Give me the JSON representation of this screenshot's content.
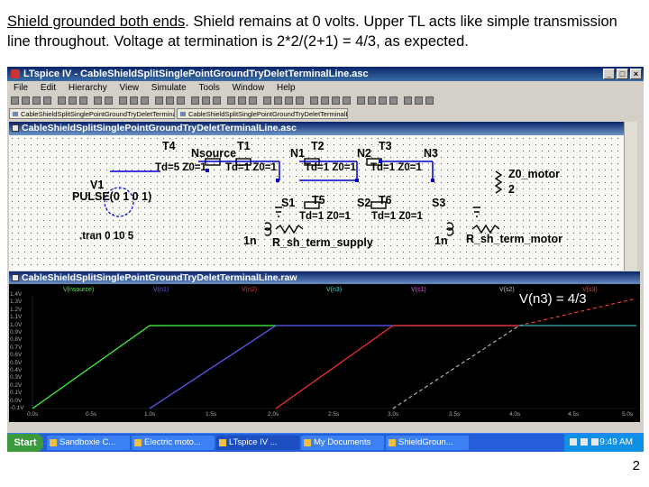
{
  "caption": {
    "part1": "Shield grounded both ends",
    "part2": ".  Shield remains at 0 volts. Upper TL acts like simple transmission line throughout.  Voltage at termination is 2*2/(2+1) = 4/3, as expected."
  },
  "slide_number": "2",
  "window": {
    "title": "LTspice IV - CableShieldSplitSinglePointGroundTryDeletTerminalLine.asc"
  },
  "menu": [
    "File",
    "Edit",
    "Hierarchy",
    "View",
    "Simulate",
    "Tools",
    "Window",
    "Help"
  ],
  "tabs": [
    "CableShieldSplitSinglePointGroundTryDeletTerminalLine.asc",
    "CableShieldSplitSinglePointGroundTryDeletTerminalLine.raw"
  ],
  "schematic": {
    "title": "CableShieldSplitSinglePointGroundTryDeletTerminalLine.asc",
    "labels": {
      "t4": "T4",
      "nsource": "Nsource",
      "t1": "T1",
      "n1": "N1",
      "t2": "T2",
      "n2": "N2",
      "t3": "T3",
      "n3": "N3",
      "td5": "Td=5 Z0=1",
      "td1a": "Td=1 Z0=1",
      "td1b": "Td=1 Z0=1",
      "td1c": "Td=1 Z0=1",
      "v1": "V1",
      "pulse": "PULSE(0 1 0 1)",
      "z0motor": "Z0_motor",
      "z0val": "2",
      "s1": "S1",
      "t5": "T5",
      "s2": "S2",
      "t6": "T6",
      "s3": "S3",
      "td1d": "Td=1 Z0=1",
      "td1e": "Td=1 Z0=1",
      "tran": ".tran 0 10 5",
      "ind1": "1n",
      "rsupply": "R_sh_term_supply",
      "ind2": "1n",
      "rmotor": "R_sh_term_motor"
    }
  },
  "waveform": {
    "title": "CableShieldSplitSinglePointGroundTryDeletTerminalLine.raw",
    "traces": [
      {
        "label": "V(nsource)",
        "color": "#40ff40"
      },
      {
        "label": "V(n1)",
        "color": "#6060ff"
      },
      {
        "label": "V(n2)",
        "color": "#ff3030"
      },
      {
        "label": "V(n3)",
        "color": "#40e0e0"
      },
      {
        "label": "V(s1)",
        "color": "#ff40ff"
      },
      {
        "label": "V(s2)",
        "color": "#c0c0c0"
      },
      {
        "label": "V(s3)",
        "color": "#ff4040"
      }
    ],
    "annotation": "V(n3) = 4/3",
    "y_ticks": [
      "1.4V",
      "1.3V",
      "1.2V",
      "1.1V",
      "1.0V",
      "0.9V",
      "0.8V",
      "0.7V",
      "0.6V",
      "0.5V",
      "0.4V",
      "0.3V",
      "0.2V",
      "0.1V",
      "0.0V",
      "-0.1V"
    ],
    "x_ticks": [
      "0.0s",
      "0.5s",
      "1.0s",
      "1.5s",
      "2.0s",
      "2.5s",
      "3.0s",
      "3.5s",
      "4.0s",
      "4.5s",
      "5.0s"
    ]
  },
  "taskbar": {
    "start": "Start",
    "buttons": [
      "Sandboxie C...",
      "Electric moto...",
      "LTspice IV ...",
      "My Documents",
      "ShieldGroun..."
    ],
    "active_index": 2,
    "clock": "9:49 AM"
  }
}
